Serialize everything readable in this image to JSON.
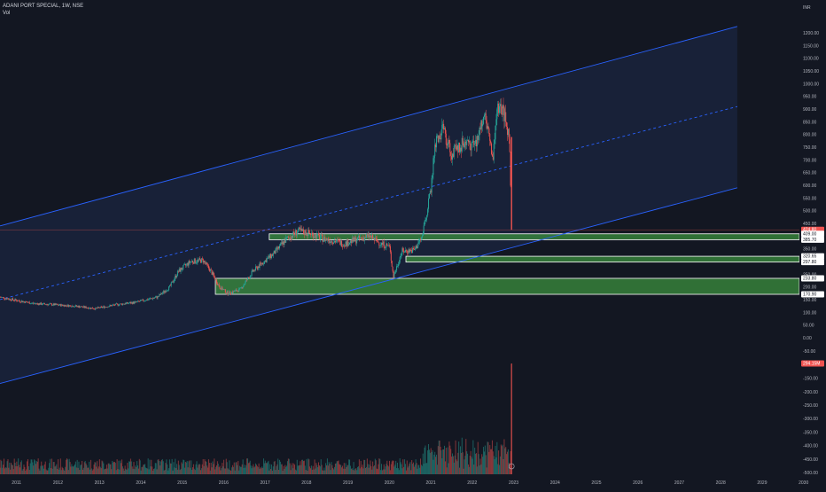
{
  "header": {
    "symbol_line": "ADANI PORT SPECIAL, 1W, NSE",
    "volume_label": "Vol"
  },
  "price_axis": {
    "currency": "INR",
    "ticks": [
      {
        "value": 1200,
        "label": "1200.00"
      },
      {
        "value": 1150,
        "label": "1150.00"
      },
      {
        "value": 1100,
        "label": "1100.00"
      },
      {
        "value": 1050,
        "label": "1050.00"
      },
      {
        "value": 1000,
        "label": "1000.00"
      },
      {
        "value": 950,
        "label": "950.00"
      },
      {
        "value": 900,
        "label": "900.00"
      },
      {
        "value": 850,
        "label": "850.00"
      },
      {
        "value": 800,
        "label": "800.00"
      },
      {
        "value": 750,
        "label": "750.00"
      },
      {
        "value": 700,
        "label": "700.00"
      },
      {
        "value": 650,
        "label": "650.00"
      },
      {
        "value": 600,
        "label": "600.00"
      },
      {
        "value": 550,
        "label": "550.00"
      },
      {
        "value": 500,
        "label": "500.00"
      },
      {
        "value": 450,
        "label": "450.00"
      },
      {
        "value": 350,
        "label": "350.00"
      },
      {
        "value": 250,
        "label": "250.00"
      },
      {
        "value": 200,
        "label": "200.00"
      },
      {
        "value": 150,
        "label": "150.00"
      },
      {
        "value": 100,
        "label": "100.00"
      },
      {
        "value": 50,
        "label": "50.00"
      },
      {
        "value": 0,
        "label": "0.00"
      },
      {
        "value": -50,
        "label": "-50.00"
      },
      {
        "value": -150,
        "label": "-150.00"
      },
      {
        "value": -200,
        "label": "-200.00"
      },
      {
        "value": -250,
        "label": "-250.00"
      },
      {
        "value": -300,
        "label": "-300.00"
      },
      {
        "value": -350,
        "label": "-350.00"
      },
      {
        "value": -400,
        "label": "-400.00"
      },
      {
        "value": -450,
        "label": "-450.00"
      },
      {
        "value": -500,
        "label": "-500.00"
      }
    ],
    "badges": [
      {
        "value": 424.8,
        "label": "424.80",
        "sublabel": "04:19:15",
        "bg": "#ef5350",
        "fg": "#ffffff"
      },
      {
        "value": 409.0,
        "label": "409.00",
        "bg": "#ffffff",
        "fg": "#131722"
      },
      {
        "value": 385.7,
        "label": "385.70",
        "bg": "#ffffff",
        "fg": "#131722"
      },
      {
        "value": 320.65,
        "label": "320.65",
        "bg": "#ffffff",
        "fg": "#131722"
      },
      {
        "value": 297.8,
        "label": "297.80",
        "bg": "#ffffff",
        "fg": "#131722"
      },
      {
        "value": 233.8,
        "label": "233.80",
        "bg": "#ffffff",
        "fg": "#131722"
      },
      {
        "value": 170.9,
        "label": "170.90",
        "bg": "#ffffff",
        "fg": "#131722"
      },
      {
        "value": -100,
        "label": "294.15M",
        "bg": "#ef5350",
        "fg": "#ffffff"
      }
    ]
  },
  "time_axis": {
    "ticks": [
      {
        "year": 2011,
        "label": "2011"
      },
      {
        "year": 2012,
        "label": "2012"
      },
      {
        "year": 2013,
        "label": "2013"
      },
      {
        "year": 2014,
        "label": "2014"
      },
      {
        "year": 2015,
        "label": "2015"
      },
      {
        "year": 2016,
        "label": "2016"
      },
      {
        "year": 2017,
        "label": "2017"
      },
      {
        "year": 2018,
        "label": "2018"
      },
      {
        "year": 2019,
        "label": "2019"
      },
      {
        "year": 2020,
        "label": "2020"
      },
      {
        "year": 2021,
        "label": "2021"
      },
      {
        "year": 2022,
        "label": "2022"
      },
      {
        "year": 2023,
        "label": "2023"
      },
      {
        "year": 2024,
        "label": "2024"
      },
      {
        "year": 2025,
        "label": "2025"
      },
      {
        "year": 2026,
        "label": "2026"
      },
      {
        "year": 2027,
        "label": "2027"
      },
      {
        "year": 2028,
        "label": "2028"
      },
      {
        "year": 2029,
        "label": "2029"
      },
      {
        "year": 2030,
        "label": "2030"
      }
    ]
  },
  "colors": {
    "background": "#131722",
    "channel_line": "#2962ff",
    "channel_fill": "#1e2a4a",
    "zone_fill": "#3b8f3e",
    "zone_border": "#ffffff",
    "candle_up": "#26a69a",
    "candle_down": "#ef5350"
  },
  "chart_data": {
    "type": "candlestick",
    "x_range": [
      2010.7,
      2030.0
    ],
    "y_range": [
      -520,
      1240
    ],
    "grid": false,
    "price_path": [
      [
        2010.7,
        160
      ],
      [
        2011.0,
        150
      ],
      [
        2011.5,
        135
      ],
      [
        2012.0,
        130
      ],
      [
        2012.5,
        125
      ],
      [
        2013.0,
        115
      ],
      [
        2013.5,
        130
      ],
      [
        2014.0,
        140
      ],
      [
        2014.5,
        160
      ],
      [
        2014.8,
        200
      ],
      [
        2015.0,
        260
      ],
      [
        2015.3,
        300
      ],
      [
        2015.6,
        305
      ],
      [
        2015.8,
        260
      ],
      [
        2016.0,
        200
      ],
      [
        2016.2,
        175
      ],
      [
        2016.5,
        190
      ],
      [
        2016.8,
        260
      ],
      [
        2017.0,
        290
      ],
      [
        2017.3,
        330
      ],
      [
        2017.6,
        385
      ],
      [
        2017.9,
        420
      ],
      [
        2018.2,
        410
      ],
      [
        2018.5,
        390
      ],
      [
        2018.8,
        380
      ],
      [
        2019.0,
        370
      ],
      [
        2019.3,
        385
      ],
      [
        2019.6,
        400
      ],
      [
        2019.9,
        370
      ],
      [
        2020.1,
        360
      ],
      [
        2020.2,
        240
      ],
      [
        2020.4,
        340
      ],
      [
        2020.7,
        345
      ],
      [
        2020.9,
        400
      ],
      [
        2021.1,
        580
      ],
      [
        2021.2,
        760
      ],
      [
        2021.4,
        820
      ],
      [
        2021.6,
        720
      ],
      [
        2021.9,
        770
      ],
      [
        2022.2,
        760
      ],
      [
        2022.4,
        900
      ],
      [
        2022.6,
        700
      ],
      [
        2022.7,
        900
      ],
      [
        2022.85,
        890
      ],
      [
        2023.0,
        780
      ],
      [
        2023.05,
        424.8
      ]
    ],
    "volume_spikes": [
      {
        "year": 2021.3,
        "value": 95
      },
      {
        "year": 2021.4,
        "value": 70
      },
      {
        "year": 2023.05,
        "value": 310
      }
    ],
    "channel": {
      "upper": [
        [
          2010.7,
          440
        ],
        [
          2028.5,
          1225
        ]
      ],
      "middle": [
        [
          2010.7,
          150
        ],
        [
          2028.5,
          910
        ]
      ],
      "lower": [
        [
          2010.7,
          -180
        ],
        [
          2028.5,
          590
        ]
      ]
    },
    "zones": [
      {
        "from_year": 2017.2,
        "to_year": 2030.0,
        "top": 409.0,
        "bottom": 385.7
      },
      {
        "from_year": 2020.5,
        "to_year": 2030.0,
        "top": 320.65,
        "bottom": 297.8
      },
      {
        "from_year": 2015.9,
        "to_year": 2030.0,
        "top": 233.8,
        "bottom": 170.9
      }
    ],
    "last_price": 424.8
  }
}
